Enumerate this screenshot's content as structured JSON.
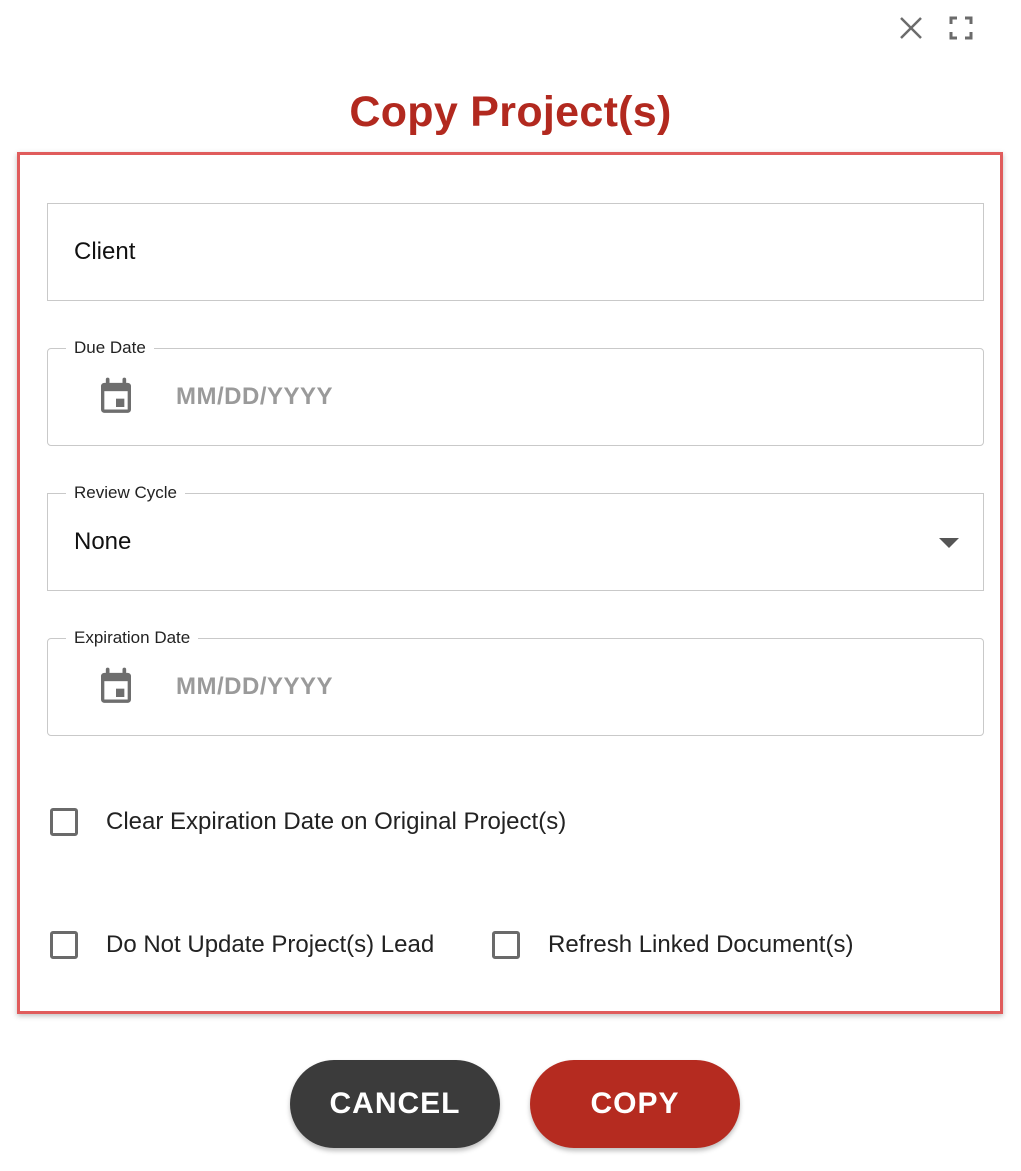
{
  "dialog": {
    "title": "Copy Project(s)"
  },
  "fields": {
    "client": {
      "value": "Client"
    },
    "due_date": {
      "label": "Due Date",
      "placeholder": "MM/DD/YYYY"
    },
    "review_cycle": {
      "label": "Review Cycle",
      "value": "None"
    },
    "expiration_date": {
      "label": "Expiration Date",
      "placeholder": "MM/DD/YYYY"
    }
  },
  "checkboxes": {
    "clear_expiration": {
      "label": "Clear Expiration Date on Original Project(s)",
      "checked": false
    },
    "do_not_update_lead": {
      "label": "Do Not Update Project(s) Lead",
      "checked": false
    },
    "refresh_linked": {
      "label": "Refresh Linked Document(s)",
      "checked": false
    }
  },
  "buttons": {
    "cancel_label": "CANCEL",
    "copy_label": "COPY"
  },
  "colors": {
    "accent": "#b2291f",
    "cancel_button": "#3b3b3b",
    "copy_button": "#b52b20",
    "frame_border": "#e05c5c"
  },
  "icons": {
    "close": "close-icon",
    "fullscreen": "fullscreen-icon",
    "calendar": "calendar-icon",
    "dropdown": "chevron-down-icon"
  }
}
